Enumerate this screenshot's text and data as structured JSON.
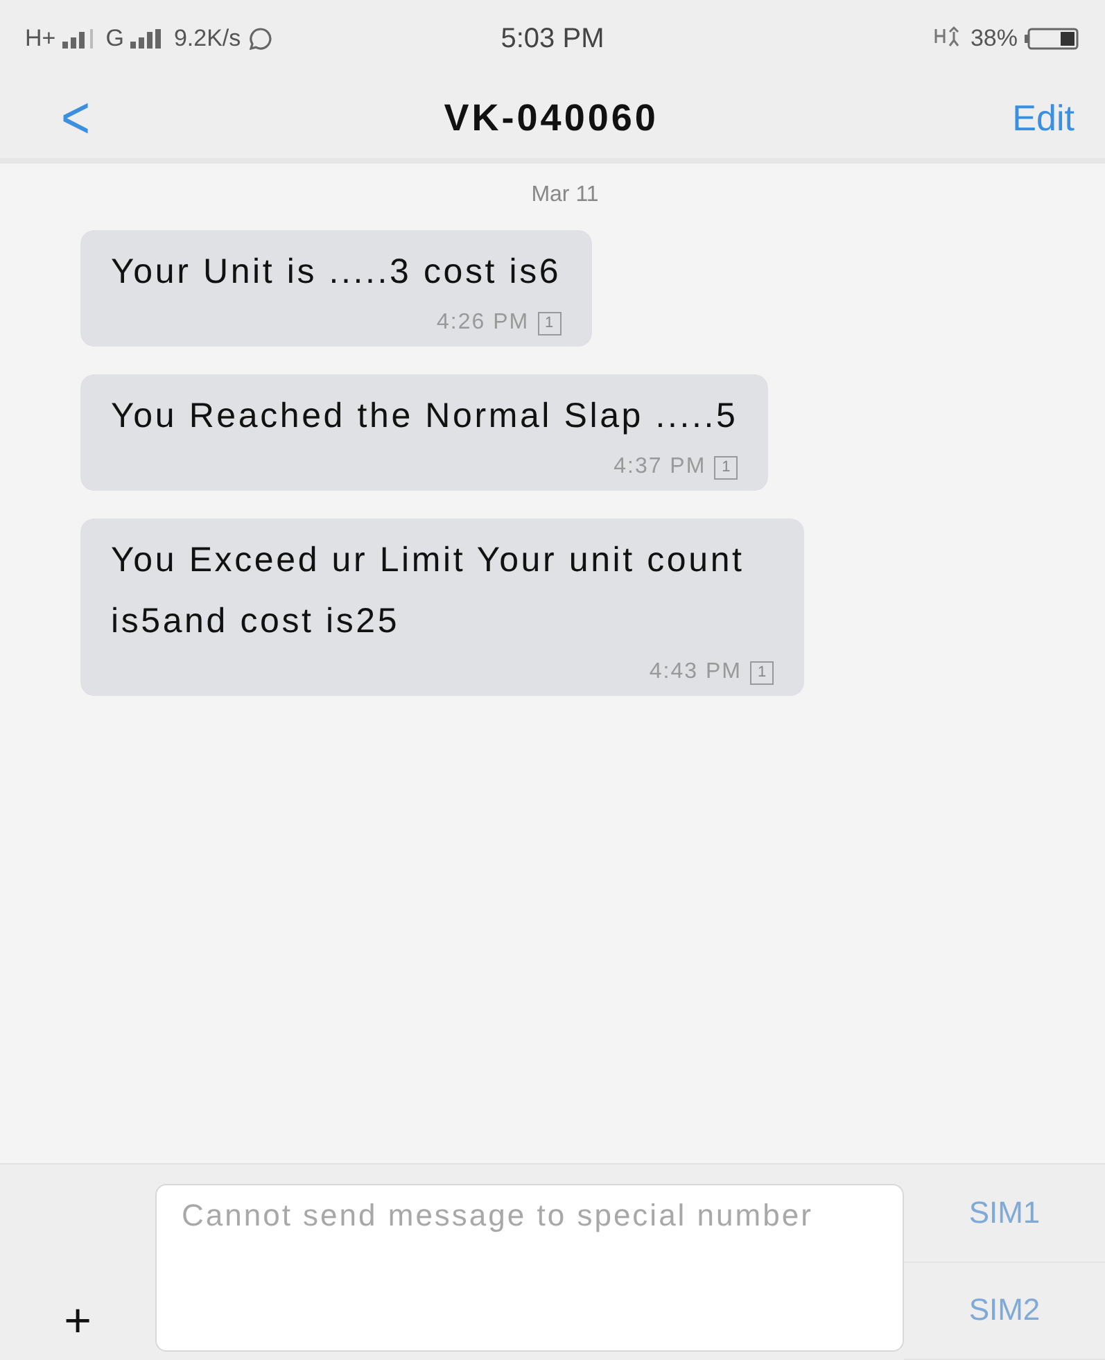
{
  "status_bar": {
    "network_1": "H+",
    "network_2": "G",
    "speed": "9.2K/s",
    "time": "5:03 PM",
    "battery": "38%"
  },
  "header": {
    "back": "<",
    "title": "VK-040060",
    "edit": "Edit"
  },
  "thread": {
    "date": "Mar 11",
    "messages": [
      {
        "text": "Your Unit is .....3 cost is6",
        "time": "4:26 PM",
        "sim": "1"
      },
      {
        "text": "You Reached the Normal Slap .....5",
        "time": "4:37 PM",
        "sim": "1"
      },
      {
        "text": "You Exceed ur Limit Your unit count is5and cost is25",
        "time": "4:43 PM",
        "sim": "1"
      }
    ]
  },
  "composer": {
    "add": "+",
    "placeholder": "Cannot send message to special number",
    "sim_buttons": [
      {
        "label": "SIM1",
        "disabled": true
      },
      {
        "label": "SIM2",
        "disabled": true
      }
    ]
  }
}
